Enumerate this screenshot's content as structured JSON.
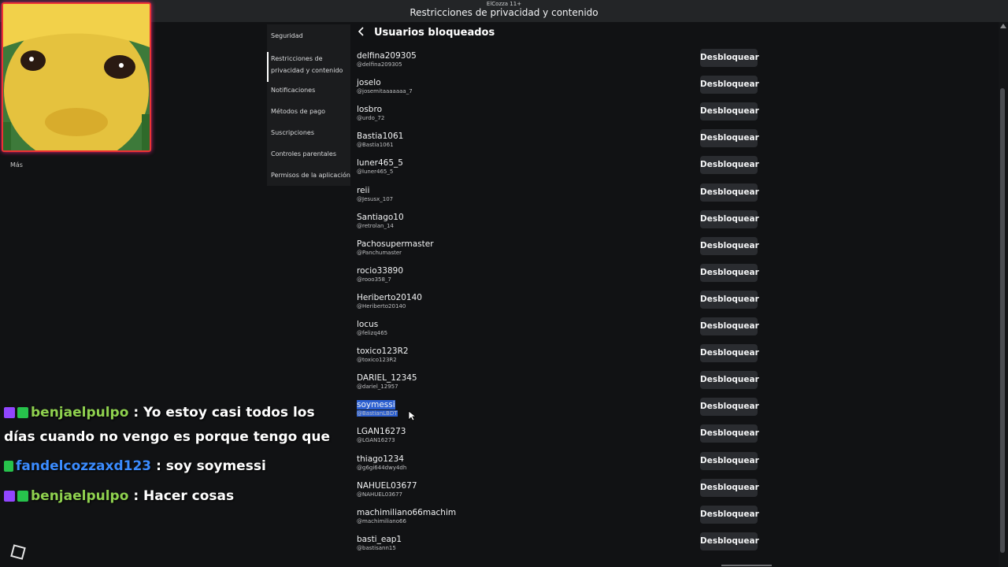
{
  "window": {
    "app_small_title": "ElCozza 11+",
    "title": "Restricciones de privacidad y contenido"
  },
  "overlay": {
    "more_label": "Más"
  },
  "sidebar": {
    "items": [
      {
        "label": "Seguridad"
      },
      {
        "label": "Restricciones de privacidad y contenido"
      },
      {
        "label": "Notificaciones"
      },
      {
        "label": "Métodos de pago"
      },
      {
        "label": "Suscripciones"
      },
      {
        "label": "Controles parentales"
      },
      {
        "label": "Permisos de la aplicación"
      }
    ]
  },
  "page": {
    "title": "Usuarios bloqueados",
    "unblock_label": "Desbloquear"
  },
  "blocked_users": [
    {
      "name": "delfina209305",
      "handle": "@delfina209305"
    },
    {
      "name": "joselo",
      "handle": "@josemitaaaaaaa_7"
    },
    {
      "name": "losbro",
      "handle": "@urdo_72"
    },
    {
      "name": "Bastia1061",
      "handle": "@Bastia1061"
    },
    {
      "name": "luner465_5",
      "handle": "@luner465_5"
    },
    {
      "name": "reii",
      "handle": "@Jesusx_107"
    },
    {
      "name": "Santiago10",
      "handle": "@retrolan_14"
    },
    {
      "name": "Pachosupermaster",
      "handle": "@Panchumaster"
    },
    {
      "name": "rocio33890",
      "handle": "@rooo358_7"
    },
    {
      "name": "Heriberto20140",
      "handle": "@Heriberto20140"
    },
    {
      "name": "locus",
      "handle": "@felizq465"
    },
    {
      "name": "toxico123R2",
      "handle": "@toxico123R2"
    },
    {
      "name": "DARIEL_12345",
      "handle": "@dariel_12957"
    },
    {
      "name": "soymessi",
      "handle": "@BastianLBDT"
    },
    {
      "name": "LGAN16273",
      "handle": "@LGAN16273"
    },
    {
      "name": "thiago1234",
      "handle": "@g6gi644dwy4dh"
    },
    {
      "name": "NAHUEL03677",
      "handle": "@NAHUEL03677"
    },
    {
      "name": "machimiliano66machim",
      "handle": "@machimiliano66"
    },
    {
      "name": "basti_eap1",
      "handle": "@bastisann15"
    }
  ],
  "chat": [
    {
      "user": "benjaelpulpo",
      "line1": ": Yo estoy casi todos los",
      "line2": "días cuando no vengo es porque tengo que"
    },
    {
      "user": "fandelcozzaxd123",
      "line1": ": soy soymessi"
    },
    {
      "user": "benjaelpulpo",
      "line1": ": Hacer cosas"
    }
  ],
  "colors": {
    "background": "#111214",
    "button": "#2a2c30",
    "selection": "#2b5fd1",
    "badge_purple": "#9146ff",
    "badge_green": "#27c24c"
  }
}
